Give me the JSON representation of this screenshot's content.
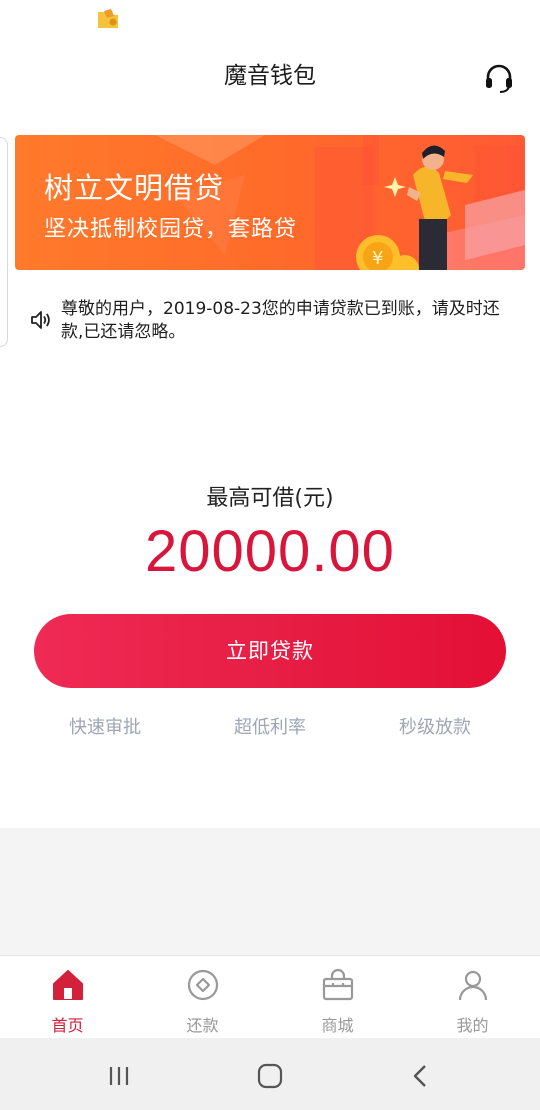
{
  "app": {
    "title": "魔音钱包"
  },
  "banner": {
    "title": "树立文明借贷",
    "subtitle": "坚决抵制校园贷，套路贷"
  },
  "notice": {
    "text": "尊敬的用户，2019-08-23您的申请贷款已到账，请及时还款,已还请忽略。"
  },
  "loan": {
    "limit_label": "最高可借(元)",
    "limit_amount": "20000.00",
    "button_label": "立即贷款"
  },
  "features": [
    "快速审批",
    "超低利率",
    "秒级放款"
  ],
  "tabs": [
    {
      "label": "首页",
      "icon": "home-icon",
      "active": true
    },
    {
      "label": "还款",
      "icon": "repay-icon",
      "active": false
    },
    {
      "label": "商城",
      "icon": "shop-bag-icon",
      "active": false
    },
    {
      "label": "我的",
      "icon": "profile-icon",
      "active": false
    }
  ],
  "colors": {
    "accent": "#d8153a",
    "banner": "#ff6a2a",
    "feature_text": "#9ea6b6",
    "tab_inactive": "#999999"
  }
}
